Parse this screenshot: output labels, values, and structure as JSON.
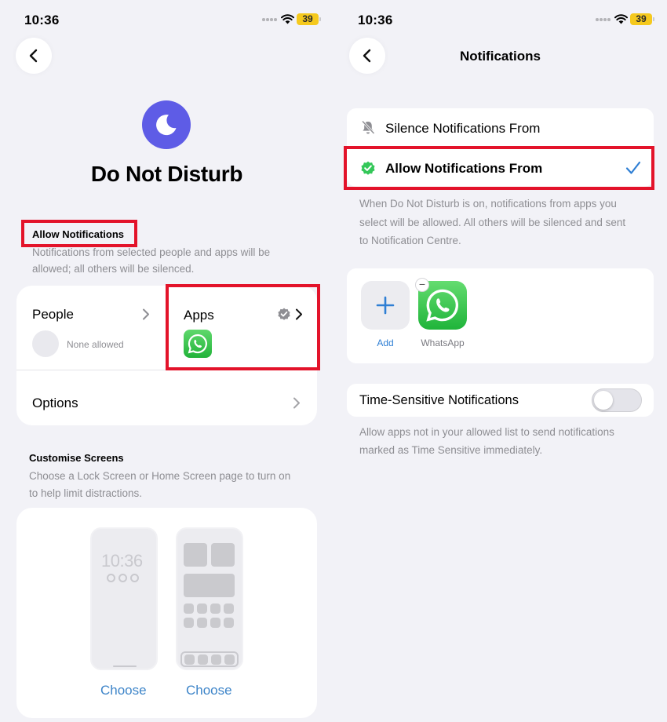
{
  "status_bar": {
    "time": "10:36",
    "battery": "39",
    "icons": [
      "cellular-dots-icon",
      "wifi-icon",
      "battery-icon"
    ]
  },
  "colors": {
    "accent_blue": "#3e85c9",
    "dnd_purple": "#5e5ce6",
    "highlight_red": "#e3132a",
    "whatsapp_green": "#25d366",
    "background": "#f2f2f7"
  },
  "left": {
    "back_icon": "chevron-left-icon",
    "focus_icon": "moon-icon",
    "title": "Do Not Disturb",
    "allow_section": {
      "header": "Allow Notifications",
      "line1": "Notifications from selected people and apps will be",
      "line2": "allowed; all others will be silenced."
    },
    "people": {
      "label": "People",
      "sublabel": "None allowed"
    },
    "apps": {
      "label": "Apps",
      "app_icon": "whatsapp-icon",
      "badge_icon": "checkmark-seal-icon"
    },
    "options": {
      "label": "Options"
    },
    "customise": {
      "header": "Customise Screens",
      "line1": "Choose a Lock Screen or Home Screen page to turn on",
      "line2": "to help limit distractions.",
      "lock_time": "10:36",
      "choose_lock": "Choose",
      "choose_home": "Choose"
    }
  },
  "right": {
    "back_icon": "chevron-left-icon",
    "title": "Notifications",
    "options": [
      {
        "label": "Silence Notifications From",
        "icon": "bell-slash-icon",
        "selected": false
      },
      {
        "label": "Allow Notifications From",
        "icon": "checkmark-seal-icon",
        "selected": true
      }
    ],
    "allow_desc": [
      "When Do Not Disturb is on, notifications from apps you",
      "select will be allowed. All others will be silenced and sent",
      "to Notification Centre."
    ],
    "apps_grid": {
      "add_label": "Add",
      "apps": [
        "WhatsApp"
      ]
    },
    "time_sensitive": {
      "label": "Time-Sensitive Notifications",
      "enabled": false,
      "desc": [
        "Allow apps not in your allowed list to send notifications",
        "marked as Time Sensitive immediately."
      ]
    }
  }
}
